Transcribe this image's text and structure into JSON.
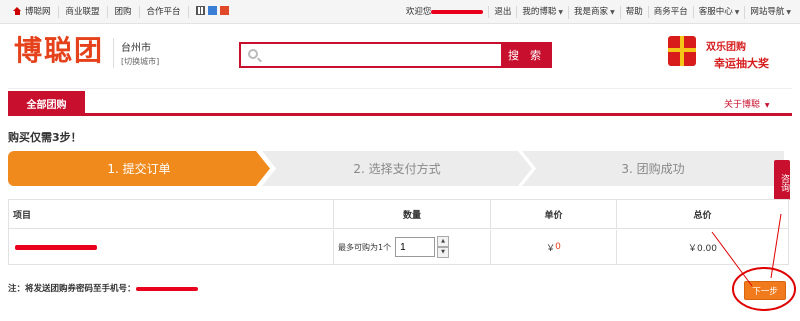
{
  "topbar": {
    "home": "博聪网",
    "links": [
      "商业联盟",
      "团购",
      "合作平台"
    ],
    "welcome": "欢迎您",
    "right_links": [
      "退出",
      "我的博聪",
      "我是商家",
      "帮助",
      "商务平台",
      "客服中心",
      "网站导航"
    ]
  },
  "header": {
    "logo": "博聪团",
    "city": "台州市",
    "switch_city": "[切换城市]",
    "search_placeholder": "",
    "search_button": "搜 索",
    "promo_line1": "双乐团购",
    "promo_line2": "幸运抽大奖"
  },
  "nav": {
    "tab": "全部团购",
    "about": "关于博聪"
  },
  "order": {
    "steps_title": "购买仅需3步！",
    "steps": [
      "1. 提交订单",
      "2. 选择支付方式",
      "3. 团购成功"
    ],
    "consult": "咨询",
    "columns": [
      "项目",
      "数量",
      "单价",
      "总价"
    ],
    "row": {
      "qty_label": "最多可购为1个",
      "qty_value": "1",
      "unit_price_symbol": "￥",
      "unit_price": "0",
      "total": "￥0.00"
    },
    "note": "注：将发送团购券密码至手机号：",
    "next_button": "下一步"
  },
  "colors": {
    "brand_red": "#c8102e",
    "step_orange": "#f08a1c",
    "logo_orange": "#e5421c"
  }
}
